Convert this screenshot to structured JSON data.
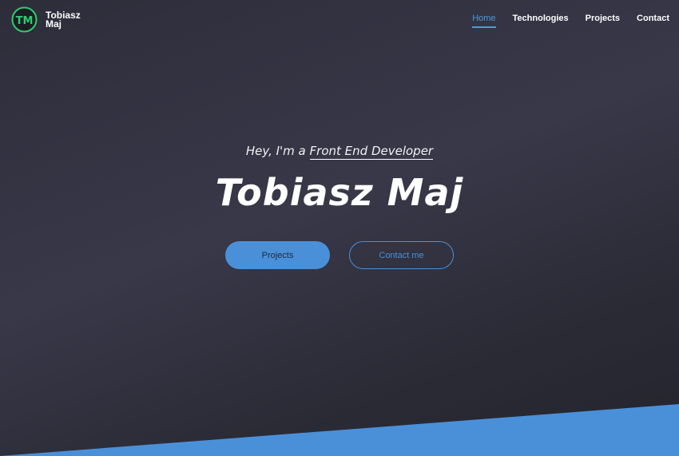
{
  "brand": {
    "logo_text": "TM",
    "name_line1": "Tobiasz",
    "name_line2": "Maj"
  },
  "nav": {
    "items": [
      {
        "label": "Home",
        "active": true
      },
      {
        "label": "Technologies",
        "active": false
      },
      {
        "label": "Projects",
        "active": false
      },
      {
        "label": "Contact",
        "active": false
      }
    ]
  },
  "hero": {
    "greeting_prefix": "Hey, I'm a",
    "greeting_role": "Front End Developer",
    "title": "Tobiasz Maj"
  },
  "buttons": {
    "projects": "Projects",
    "contact": "Contact me"
  },
  "colors": {
    "accent": "#4a90d9",
    "logo_green": "#2ecc71",
    "background": "#2f2f3c"
  },
  "icons": {
    "logo": "tm-monogram-logo"
  }
}
